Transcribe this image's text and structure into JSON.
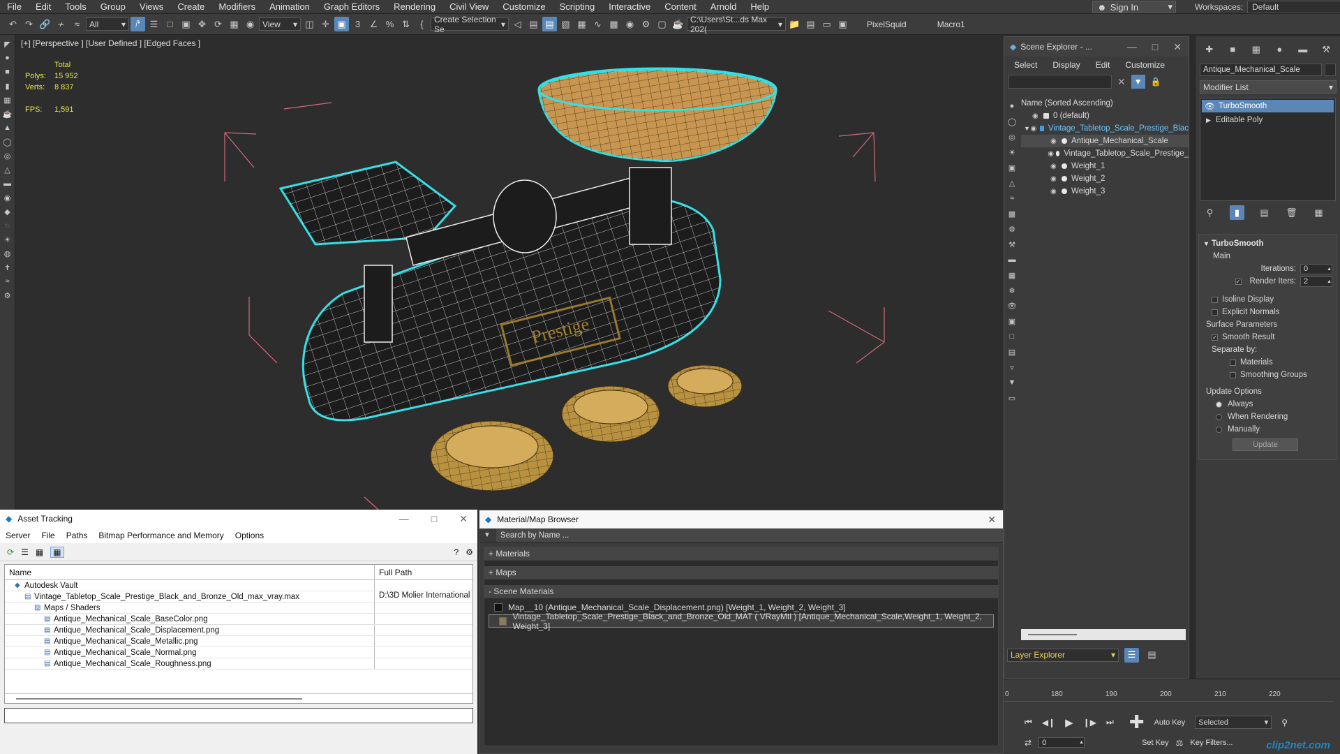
{
  "menu": [
    "File",
    "Edit",
    "Tools",
    "Group",
    "Views",
    "Create",
    "Modifiers",
    "Animation",
    "Graph Editors",
    "Rendering",
    "Civil View",
    "Customize",
    "Scripting",
    "Interactive",
    "Content",
    "Arnold",
    "Help"
  ],
  "signin": "Sign In",
  "workspaces": {
    "label": "Workspaces:",
    "value": "Default"
  },
  "toolbar": {
    "filter": "All",
    "refcoord": "View",
    "selset": "Create Selection Se",
    "path": "C:\\Users\\St...ds Max 202(",
    "plugin1": "PixelSquid",
    "plugin2": "Macro1"
  },
  "viewport": {
    "label": "[+] [Perspective ] [User Defined ] [Edged Faces ]",
    "stats": {
      "total": "Total",
      "polys_label": "Polys:",
      "polys": "15 952",
      "verts_label": "Verts:",
      "verts": "8 837",
      "fps_label": "FPS:",
      "fps": "1,591"
    }
  },
  "scene_explorer": {
    "title": "Scene Explorer - ...",
    "menu": [
      "Select",
      "Display",
      "Edit",
      "Customize"
    ],
    "column": "Name (Sorted Ascending)",
    "items": [
      {
        "label": "0 (default)",
        "indent": 0
      },
      {
        "label": "Vintage_Tabletop_Scale_Prestige_Blac",
        "indent": 0,
        "highlight": true
      },
      {
        "label": "Antique_Mechanical_Scale",
        "indent": 1,
        "selected": true
      },
      {
        "label": "Vintage_Tabletop_Scale_Prestige_",
        "indent": 1
      },
      {
        "label": "Weight_1",
        "indent": 1
      },
      {
        "label": "Weight_2",
        "indent": 1
      },
      {
        "label": "Weight_3",
        "indent": 1
      }
    ],
    "layer_explorer": "Layer Explorer"
  },
  "command_panel": {
    "object_name": "Antique_Mechanical_Scale",
    "modifier_list": "Modifier List",
    "stack": [
      "TurboSmooth",
      "Editable Poly"
    ],
    "rollout": "TurboSmooth",
    "main": "Main",
    "iterations_label": "Iterations:",
    "iterations": "0",
    "render_iters_label": "Render Iters:",
    "render_iters": "2",
    "isoline": "Isoline Display",
    "explicit": "Explicit Normals",
    "surface_params": "Surface Parameters",
    "smooth_result": "Smooth Result",
    "separate_by": "Separate by:",
    "materials": "Materials",
    "smoothing_groups": "Smoothing Groups",
    "update_options": "Update Options",
    "always": "Always",
    "when_rendering": "When Rendering",
    "manually": "Manually",
    "update_btn": "Update"
  },
  "asset_tracking": {
    "title": "Asset Tracking",
    "menu": [
      "Server",
      "File",
      "Paths",
      "Bitmap Performance and Memory",
      "Options"
    ],
    "col_name": "Name",
    "col_path": "Full Path",
    "rows": [
      {
        "name": "Autodesk Vault",
        "path": "",
        "indent": 1
      },
      {
        "name": "Vintage_Tabletop_Scale_Prestige_Black_and_Bronze_Old_max_vray.max",
        "path": "D:\\3D Molier International",
        "indent": 2
      },
      {
        "name": "Maps / Shaders",
        "path": "",
        "indent": 3
      },
      {
        "name": "Antique_Mechanical_Scale_BaseColor.png",
        "path": "",
        "indent": 4
      },
      {
        "name": "Antique_Mechanical_Scale_Displacement.png",
        "path": "",
        "indent": 4
      },
      {
        "name": "Antique_Mechanical_Scale_Metallic.png",
        "path": "",
        "indent": 4
      },
      {
        "name": "Antique_Mechanical_Scale_Normal.png",
        "path": "",
        "indent": 4
      },
      {
        "name": "Antique_Mechanical_Scale_Roughness.png",
        "path": "",
        "indent": 4
      }
    ]
  },
  "material_browser": {
    "title": "Material/Map Browser",
    "search": "Search by Name ...",
    "groups": [
      "+ Materials",
      "+ Maps",
      "- Scene Materials"
    ],
    "items": [
      "Map__10 (Antique_Mechanical_Scale_Displacement.png)  [Weight_1, Weight_2, Weight_3]",
      "Vintage_Tabletop_Scale_Prestige_Black_and_Bronze_Old_MAT  ( VRayMtl )  [Antique_Mechanical_Scale,Weight_1, Weight_2, Weight_3]"
    ]
  },
  "timeline": {
    "ticks": [
      "0",
      "180",
      "190",
      "200",
      "210",
      "220"
    ],
    "autokey": "Auto Key",
    "setkey": "Set Key",
    "selected": "Selected",
    "keyfilters": "Key Filters...",
    "frame": "0"
  },
  "watermark": "clip2net.com"
}
